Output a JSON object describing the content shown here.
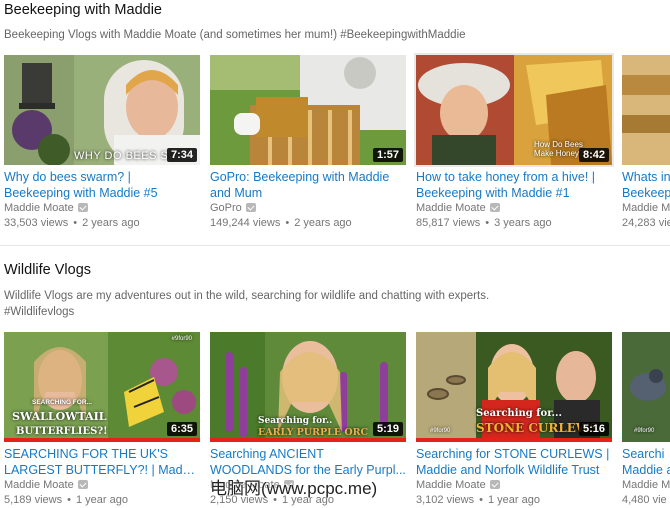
{
  "shelves": [
    {
      "title": "Beekeeping with Maddie",
      "description": "Beekeeping Vlogs with Maddie Moate (and sometimes her mum!) #BeekeepingwithMaddie",
      "videos": [
        {
          "title_line1": "Why do bees swarm? |",
          "title_line2": "Beekeeping with Maddie #5",
          "overlay": "WHY DO BEES SWA",
          "duration": "7:34",
          "channel": "Maddie Moate",
          "views": "33,503 views",
          "age": "2 years ago"
        },
        {
          "title_line1": "GoPro: Beekeeping with Maddie",
          "title_line2": "and Mum",
          "overlay": "",
          "duration": "1:57",
          "channel": "GoPro",
          "views": "149,244 views",
          "age": "2 years ago"
        },
        {
          "title_line1": "How to take honey from a hive! |",
          "title_line2": "Beekeeping with Maddie #1",
          "overlay": "How Do Bees Make Honey?",
          "duration": "8:42",
          "channel": "Maddie Moate",
          "views": "85,817 views",
          "age": "3 years ago"
        },
        {
          "title_line1": "Whats in",
          "title_line2": "Beekeep",
          "overlay": "",
          "duration": "",
          "channel": "Maddie M",
          "views": "24,283 vie",
          "age": ""
        }
      ]
    },
    {
      "title": "Wildlife Vlogs",
      "description": "Wildlife Vlogs are my adventures out in the wild, searching for wildlife and chatting with experts. #Wildlifevlogs",
      "videos": [
        {
          "title_line1": "SEARCHING FOR THE UK'S",
          "title_line2": "LARGEST BUTTERFLY?! | Maddi...",
          "overlay": "SEARCHING FOR...",
          "overlay2": "SWALLOWTAIL",
          "overlay3": "BUTTERFLIES?!",
          "duration": "6:35",
          "channel": "Maddie Moate",
          "views": "5,189 views",
          "age": "1 year ago"
        },
        {
          "title_line1": "Searching ANCIENT",
          "title_line2": "WOODLANDS for the Early Purpl...",
          "overlay": "Searching for..",
          "overlay2": "EARLY PURPLE ORC",
          "duration": "5:19",
          "channel": "Maddie Moate",
          "views": "2,150 views",
          "age": "1 year ago"
        },
        {
          "title_line1": "Searching for STONE CURLEWS |",
          "title_line2": "Maddie and Norfolk Wildlife Trust",
          "overlay": "Searching for...",
          "overlay2": "STONE CURLEWS",
          "duration": "5:16",
          "channel": "Maddie Moate",
          "views": "3,102 views",
          "age": "1 year ago"
        },
        {
          "title_line1": "Searchi",
          "title_line2": "Maddie a",
          "overlay": "",
          "duration": "",
          "channel": "Maddie M",
          "views": "4,480 vie",
          "age": ""
        }
      ]
    }
  ],
  "tags": {
    "t1": "#9for90",
    "t2": "#9for90",
    "t3": "#9for90"
  },
  "watermark": "电脑网(www.pcpc.me)",
  "colors": {
    "link": "#167ac6",
    "meta": "#767676",
    "progress": "#e62117"
  }
}
